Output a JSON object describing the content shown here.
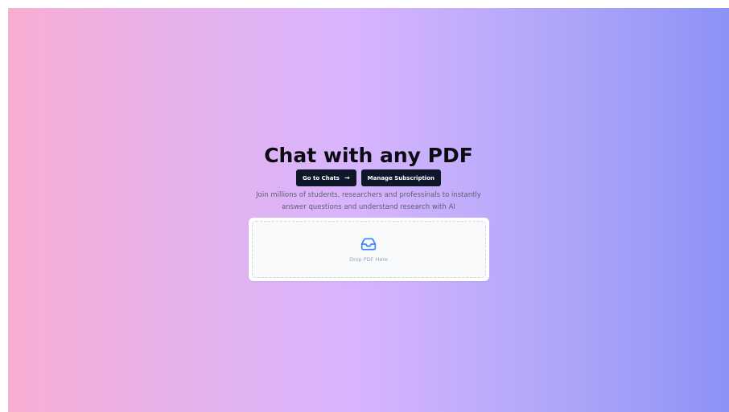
{
  "hero": {
    "title": "Chat with any PDF",
    "subtitle": "Join millions of students, researchers and professinals to instantly answer questions and understand research with AI"
  },
  "buttons": {
    "go_to_chats": "Go to Chats",
    "go_to_chats_icon": "arrow-right-icon",
    "manage_subscription": "Manage Subscription"
  },
  "upload": {
    "icon": "inbox-icon",
    "label": "Drop PDF Here"
  },
  "colors": {
    "button_bg": "#0f172a",
    "icon_blue": "#3b82f6",
    "gradient_start": "#f9aed3",
    "gradient_mid": "#d8b4fe",
    "gradient_end": "#8d92f6"
  }
}
